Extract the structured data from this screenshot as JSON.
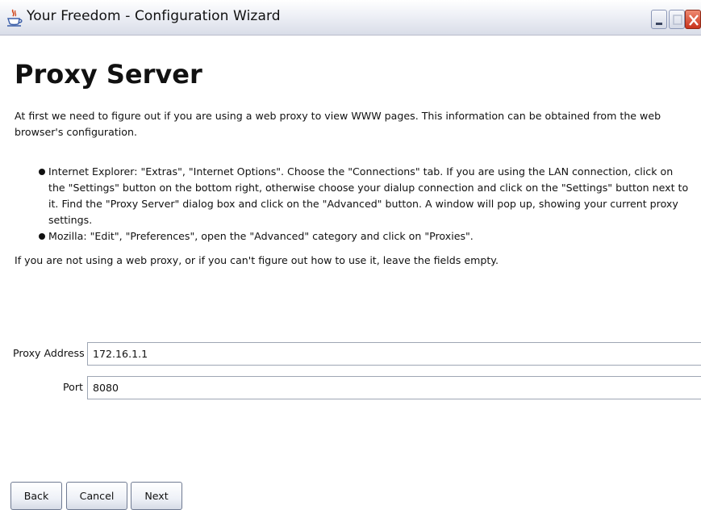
{
  "window": {
    "title": "Your Freedom - Configuration Wizard",
    "icon": "java-coffee-cup-icon"
  },
  "page": {
    "heading": "Proxy Server",
    "intro": "At first we need to figure out if you are using a web proxy to view WWW pages. This information can be obtained from the web browser's configuration.",
    "bullets": [
      "Internet Explorer: \"Extras\", \"Internet Options\". Choose the \"Connections\" tab. If you are using the LAN connection, click on the \"Settings\" button on the bottom right, otherwise choose your dialup connection and click on the \"Settings\" button next to it. Find the \"Proxy Server\" dialog box and click on the \"Advanced\" button. A window will pop up, showing your current proxy settings.",
      "Mozilla: \"Edit\", \"Preferences\", open the \"Advanced\" category and click on \"Proxies\"."
    ],
    "note": "If you are not using a web proxy, or if you can't figure out how to use it, leave the fields empty."
  },
  "form": {
    "proxy_address_label": "Proxy Address",
    "proxy_address_value": "172.16.1.1",
    "port_label": "Port",
    "port_value": "8080"
  },
  "buttons": {
    "back": "Back",
    "cancel": "Cancel",
    "next": "Next"
  }
}
